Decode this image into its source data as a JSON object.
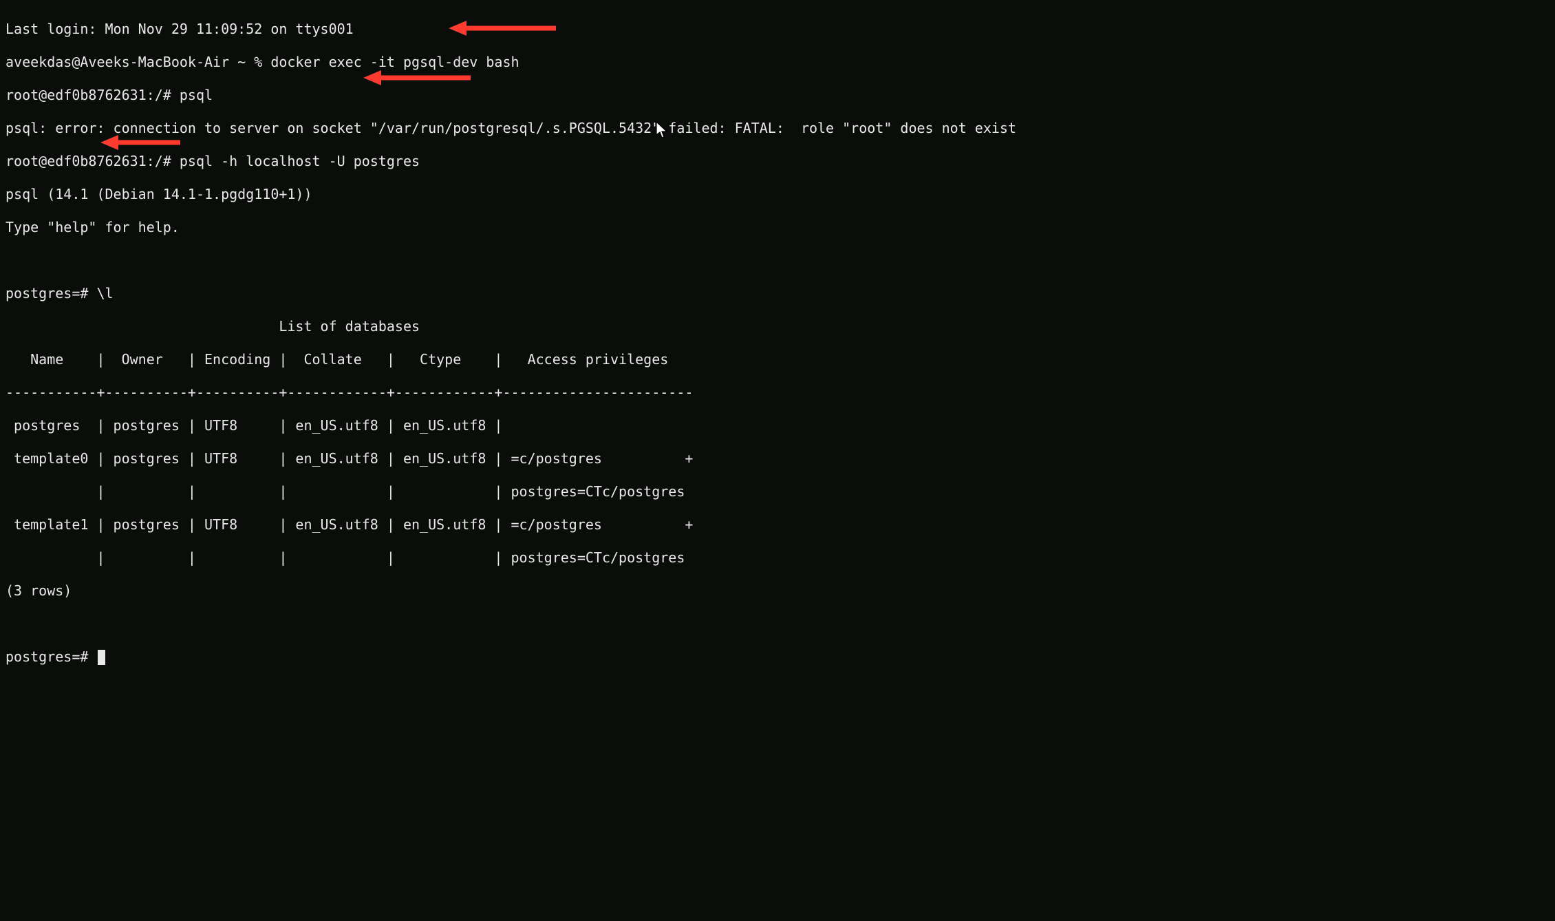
{
  "lines": {
    "last_login": "Last login: Mon Nov 29 11:09:52 on ttys001",
    "docker_cmd": "aveekdas@Aveeks-MacBook-Air ~ % docker exec -it pgsql-dev bash",
    "root_psql": "root@edf0b8762631:/# psql",
    "psql_error": "psql: error: connection to server on socket \"/var/run/postgresql/.s.PGSQL.5432\" failed: FATAL:  role \"root\" does not exist",
    "root_psql_h": "root@edf0b8762631:/# psql -h localhost -U postgres",
    "psql_version": "psql (14.1 (Debian 14.1-1.pgdg110+1))",
    "type_help": "Type \"help\" for help.",
    "blank1": "",
    "pg_l": "postgres=# \\l",
    "list_header": "                                 List of databases",
    "col_headers": "   Name    |  Owner   | Encoding |  Collate   |   Ctype    |   Access privileges   ",
    "divider": "-----------+----------+----------+------------+------------+-----------------------",
    "row_postgres": " postgres  | postgres | UTF8     | en_US.utf8 | en_US.utf8 | ",
    "row_t0_1": " template0 | postgres | UTF8     | en_US.utf8 | en_US.utf8 | =c/postgres          +",
    "row_t0_2": "           |          |          |            |            | postgres=CTc/postgres",
    "row_t1_1": " template1 | postgres | UTF8     | en_US.utf8 | en_US.utf8 | =c/postgres          +",
    "row_t1_2": "           |          |          |            |            | postgres=CTc/postgres",
    "rows_count": "(3 rows)",
    "blank2": "",
    "prompt": "postgres=# "
  },
  "annotations": {
    "arrow_color": "#ff3b30"
  }
}
